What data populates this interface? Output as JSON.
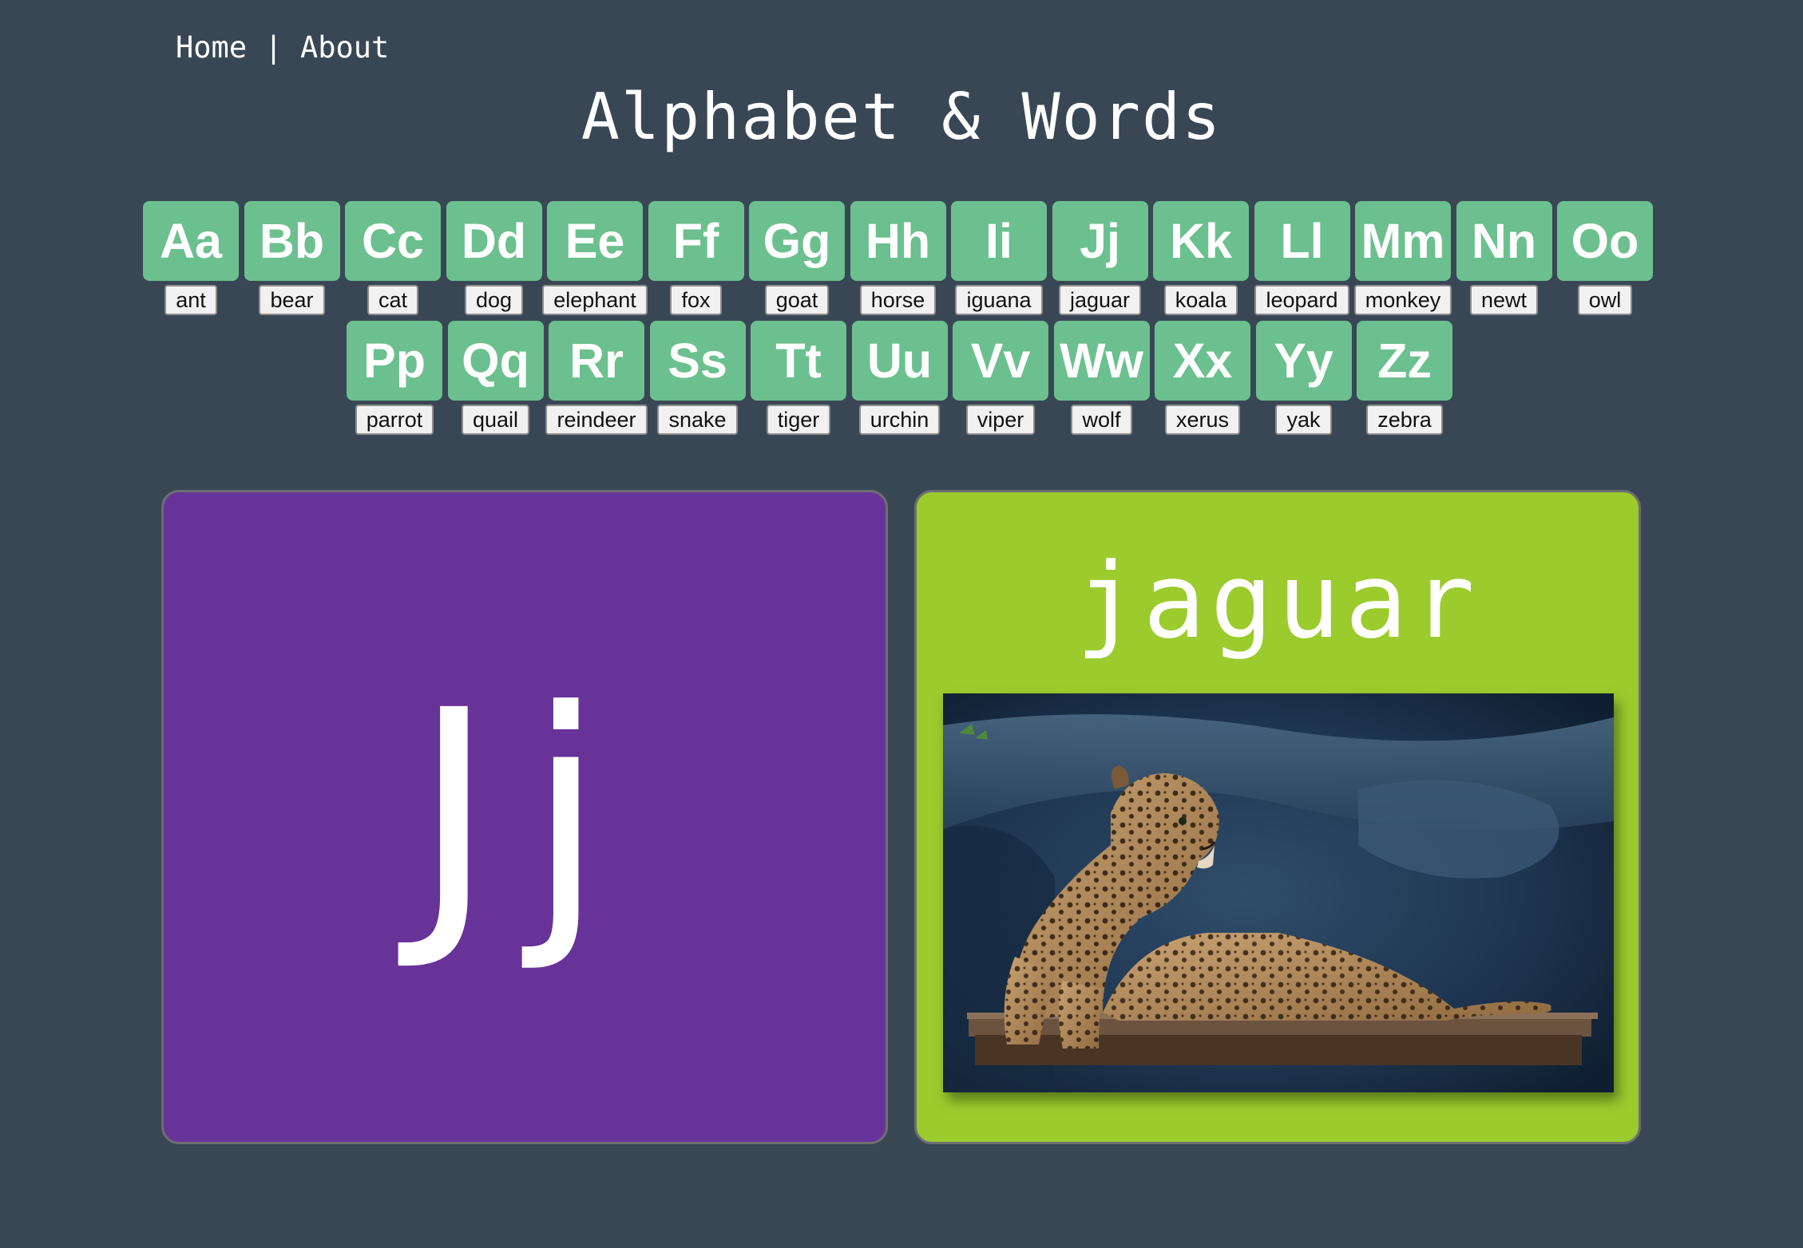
{
  "nav": {
    "home": "Home",
    "separator": " | ",
    "about": "About"
  },
  "title": "Alphabet & Words",
  "letters": {
    "row1": [
      {
        "letter": "Aa",
        "word": "ant"
      },
      {
        "letter": "Bb",
        "word": "bear"
      },
      {
        "letter": "Cc",
        "word": "cat"
      },
      {
        "letter": "Dd",
        "word": "dog"
      },
      {
        "letter": "Ee",
        "word": "elephant"
      },
      {
        "letter": "Ff",
        "word": "fox"
      },
      {
        "letter": "Gg",
        "word": "goat"
      },
      {
        "letter": "Hh",
        "word": "horse"
      },
      {
        "letter": "Ii",
        "word": "iguana"
      },
      {
        "letter": "Jj",
        "word": "jaguar"
      },
      {
        "letter": "Kk",
        "word": "koala"
      },
      {
        "letter": "Ll",
        "word": "leopard"
      },
      {
        "letter": "Mm",
        "word": "monkey"
      },
      {
        "letter": "Nn",
        "word": "newt"
      },
      {
        "letter": "Oo",
        "word": "owl"
      }
    ],
    "row2": [
      {
        "letter": "Pp",
        "word": "parrot"
      },
      {
        "letter": "Qq",
        "word": "quail"
      },
      {
        "letter": "Rr",
        "word": "reindeer"
      },
      {
        "letter": "Ss",
        "word": "snake"
      },
      {
        "letter": "Tt",
        "word": "tiger"
      },
      {
        "letter": "Uu",
        "word": "urchin"
      },
      {
        "letter": "Vv",
        "word": "viper"
      },
      {
        "letter": "Ww",
        "word": "wolf"
      },
      {
        "letter": "Xx",
        "word": "xerus"
      },
      {
        "letter": "Yy",
        "word": "yak"
      },
      {
        "letter": "Zz",
        "word": "zebra"
      }
    ]
  },
  "selected": {
    "letter": "Jj",
    "word": "jaguar",
    "image": "jaguar-photo"
  },
  "colors": {
    "background": "#394755",
    "tile": "#6cc08f",
    "letter_card": "#673399",
    "word_card": "#9ccb2e"
  }
}
